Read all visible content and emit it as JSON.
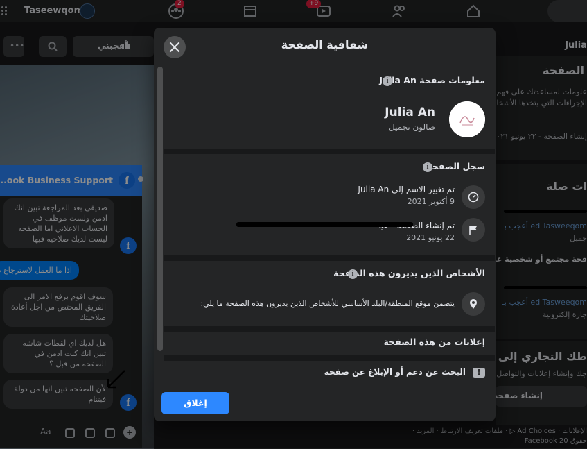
{
  "topbar": {
    "brand": "Taseewqom",
    "badges": {
      "groups": "2",
      "watch": "+9"
    }
  },
  "left_page": {
    "like_label": "أعجبني"
  },
  "chat": {
    "header_title": "...ook Business Support",
    "messages": [
      "صديقي بعد المراجعة تبين انك ادمن ولست موظف في الحساب الاعلاني اما الصفحه ليست لديك صلاحيه فيها",
      "اذا ما العمل لاسترجاع صلاحية",
      "سوف اقوم برفع الامر الى الفريق المختص من اجل أعادة صلاحيتك",
      "هل لديك اي لقطات شاشه تبين انك كنت ادمن في الصفحه من قبل ؟",
      "لأن الصفحه تبين انها من دولة فيتنام"
    ],
    "input_placeholder": "Aa"
  },
  "right_page": {
    "name": "Julia",
    "heading": "الصفحة",
    "desc1": "علومات لمساعدتك على فهم ال",
    "desc2": "الإجراءات التي يتخذها الأشخا",
    "created": "إنشاء الصفحة - ٢٢ يونيو ٢٠٢١",
    "related_title": "ات صلة",
    "liked_by": "ed Tasweeqom أعجب بـ",
    "beauty": "جميل",
    "community": "فحة مجتمع أو شخصية عامة",
    "liked_by2": "ed Tasweeqom أعجب بـ",
    "ecommerce": "جارة إلكترونية",
    "business_title": "طك التجاري إلى فيس",
    "business_desc": "جك وإنشاء إعلانات والتواصل مع",
    "create_page": "إنشاء صفحة",
    "footer1": "الإعلانات · Ad Choices ▷ · ملفات تعريف الارتباط · المزيد ·",
    "footer2": "حقوق Facebook 20"
  },
  "modal": {
    "title": "شفافية الصفحة",
    "info_section": {
      "title": "معلومات صفحة Julia An",
      "page_name": "Julia An",
      "category": "صالون تجميل"
    },
    "history_section": {
      "title": "سجل الصفحة",
      "items": [
        {
          "main": "تم تغيير الاسم إلى Julia An",
          "date": "9 أكتوبر 2021"
        },
        {
          "main": "تم إنشاء الصفحة - عيادة...",
          "date": "22 يونيو 2021"
        }
      ]
    },
    "managers_section": {
      "title": "الأشخاص الذين يديرون هذه الصفحة",
      "location_text": "يتضمن موقع المنطقة/البلد الأساسي للأشخاص الذين يديرون هذه الصفحة ما يلي:"
    },
    "ads_section": {
      "title": "إعلانات من هذه الصفحة"
    },
    "report_label": "البحث عن دعم أو الإبلاغ عن صفحة",
    "close_label": "إغلاق"
  },
  "colors": {
    "accent": "#2d88ff",
    "modal_bg": "#242526",
    "page_bg": "#18191a"
  }
}
